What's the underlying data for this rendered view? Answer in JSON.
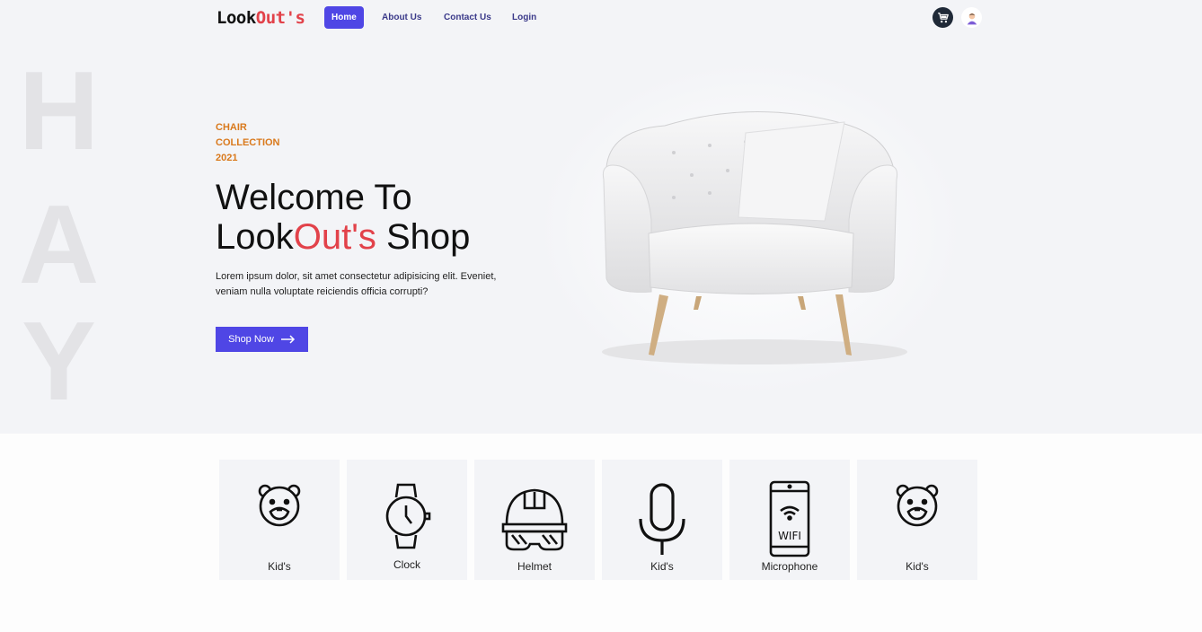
{
  "logo": {
    "part1": "Look",
    "part2": "Out's"
  },
  "nav": {
    "items": [
      {
        "label": "Home"
      },
      {
        "label": "About Us"
      },
      {
        "label": "Contact Us"
      },
      {
        "label": "Login"
      }
    ],
    "cart_icon": "cart-icon",
    "avatar_icon": "user-avatar"
  },
  "background_letters": [
    "H",
    "A",
    "Y"
  ],
  "hero": {
    "eyebrow_lines": [
      "CHAIR",
      "COLLECTION",
      "2021"
    ],
    "title_line1": "Welcome To",
    "title_look": "Look",
    "title_out": "Out's",
    "title_shop": " Shop",
    "description": "Lorem ipsum dolor, sit amet consectetur adipisicing elit. Eveniet, veniam nulla voluptate reiciendis officia corrupti?",
    "button_label": "Shop Now"
  },
  "categories": [
    {
      "label": "Kid's",
      "icon": "bear-icon"
    },
    {
      "label": "Clock",
      "icon": "watch-icon"
    },
    {
      "label": "Helmet",
      "icon": "helmet-icon"
    },
    {
      "label": "Kid's",
      "icon": "microphone-icon"
    },
    {
      "label": "Microphone",
      "icon": "phone-wifi-icon"
    },
    {
      "label": "Kid's",
      "icon": "bear-icon"
    }
  ],
  "colors": {
    "accent": "#4f46e5",
    "brand_red": "#e2424a",
    "eyebrow": "#d9791c",
    "hero_bg": "#f3f4f7"
  }
}
